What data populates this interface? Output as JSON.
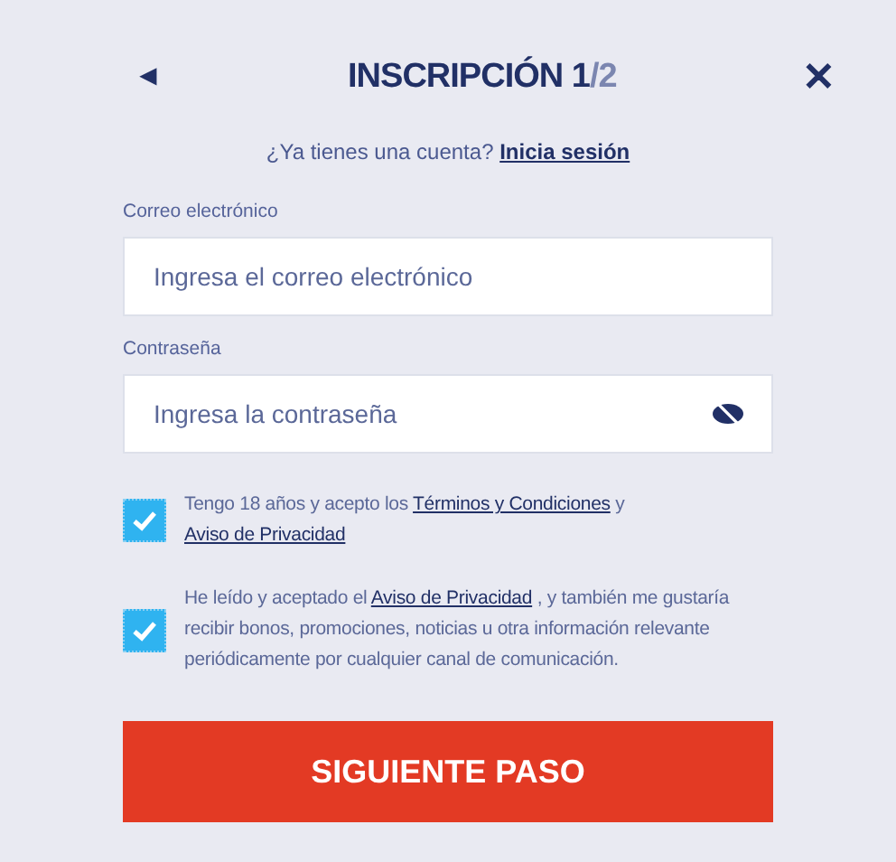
{
  "header": {
    "back": "◄",
    "title": "INSCRIPCIÓN 1",
    "title_total": "/2",
    "close": "✕"
  },
  "login_prompt": {
    "text": "¿Ya tienes una cuenta?",
    "link": "Inicia sesión"
  },
  "fields": [
    {
      "kind": "email",
      "label": "Correo electrónico",
      "placeholder": "Ingresa el correo electrónico"
    },
    {
      "kind": "password",
      "label": "Contraseña",
      "placeholder": "Ingresa la contraseña"
    }
  ],
  "consents": [
    {
      "checked": true,
      "parts": [
        {
          "kind": "text",
          "text": "Tengo 18 años y acepto los "
        },
        {
          "kind": "link",
          "text": "Términos y Condiciones"
        },
        {
          "kind": "text",
          "text": " y "
        },
        {
          "kind": "link",
          "text": "Aviso de Privacidad"
        }
      ]
    },
    {
      "checked": true,
      "parts": [
        {
          "kind": "text",
          "text": "He leído y aceptado el "
        },
        {
          "kind": "link",
          "text": "Aviso de Privacidad"
        },
        {
          "kind": "text",
          "text": " , y también me gustaría recibir bonos, promociones, noticias u otra información relevante periódicamente por cualquier canal de comunicación."
        }
      ]
    }
  ],
  "submit": "SIGUIENTE PASO"
}
